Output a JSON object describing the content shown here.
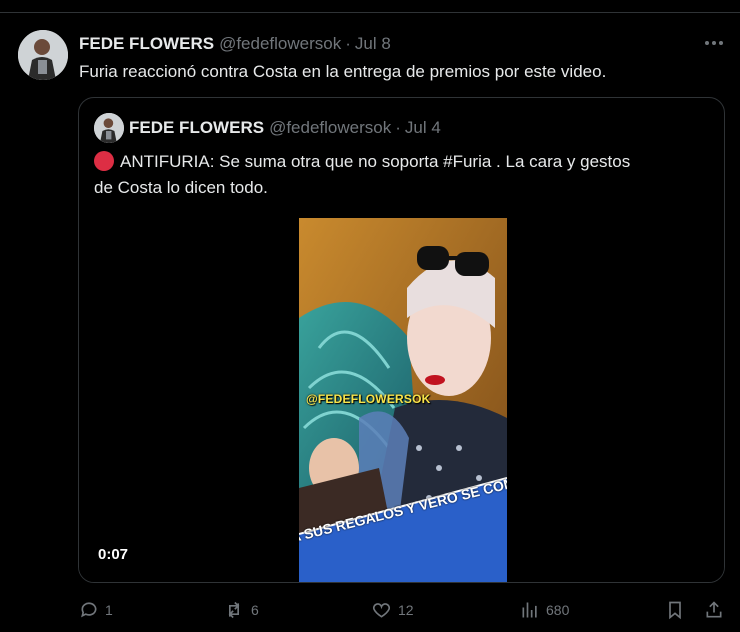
{
  "tweet": {
    "author": {
      "name": "FEDE FLOWERS",
      "handle": "@fedeflowersok",
      "separator": "·",
      "date": "Jul 8"
    },
    "text": "Furia reaccionó contra Costa en la entrega de premios por este video.",
    "quoted": {
      "author": {
        "name": "FEDE FLOWERS",
        "handle": "@fedeflowersok",
        "separator": "·",
        "date": "Jul 4"
      },
      "text_line1": "ANTIFURIA: Se suma otra que no soporta #Furia . La cara y gestos",
      "text_line2": "de Costa lo dicen todo.",
      "video": {
        "watermark": "@FEDEFLOWERSOK",
        "ticker": "A SUS REGALOS Y VERO SE COME EL CHOCOLA",
        "timestamp": "0:07"
      }
    },
    "actions": {
      "replies": "1",
      "reposts": "6",
      "likes": "12",
      "views": "680"
    },
    "icons": {
      "more": "more-horizontal-icon",
      "reply": "reply-icon",
      "repost": "repost-icon",
      "like": "heart-icon",
      "views": "views-chart-icon",
      "bookmark": "bookmark-icon",
      "share": "share-icon"
    },
    "colors": {
      "background": "#000000",
      "text": "#e7e9ea",
      "muted": "#71767b",
      "border": "#2f3336",
      "red_circle": "#dd2e44"
    }
  }
}
